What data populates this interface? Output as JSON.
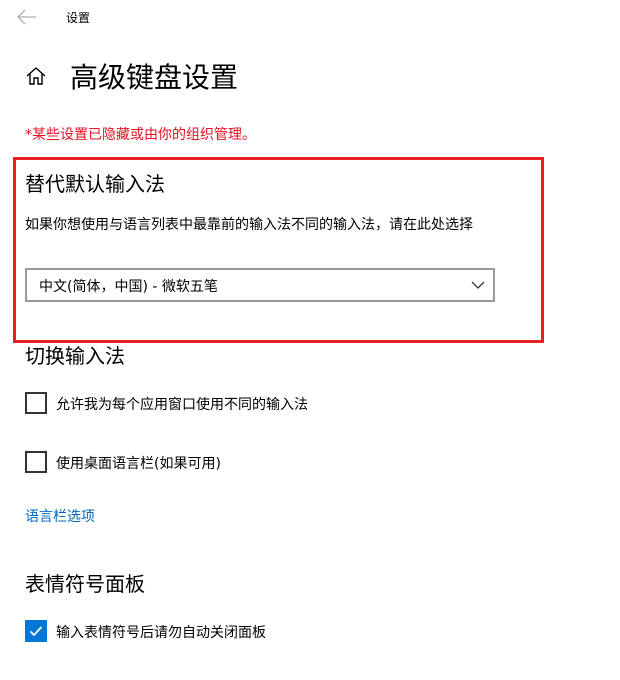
{
  "app": {
    "title": "设置"
  },
  "page": {
    "title": "高级键盘设置",
    "managed_note": "*某些设置已隐藏或由你的组织管理。"
  },
  "override_input": {
    "heading": "替代默认输入法",
    "description": "如果你想使用与语言列表中最靠前的输入法不同的输入法，请在此处选择",
    "selected_value": "中文(简体，中国) - 微软五笔"
  },
  "switch_input": {
    "heading": "切换输入法",
    "options": [
      {
        "label": "允许我为每个应用窗口使用不同的输入法",
        "checked": false
      },
      {
        "label": "使用桌面语言栏(如果可用)",
        "checked": false
      }
    ],
    "language_bar_link": "语言栏选项"
  },
  "emoji_panel": {
    "heading": "表情符号面板",
    "options": [
      {
        "label": "输入表情符号后请勿自动关闭面板",
        "checked": true
      }
    ]
  },
  "colors": {
    "accent": "#0078d7",
    "link": "#0067c0",
    "warning": "#e81123",
    "highlight": "#e32126"
  }
}
